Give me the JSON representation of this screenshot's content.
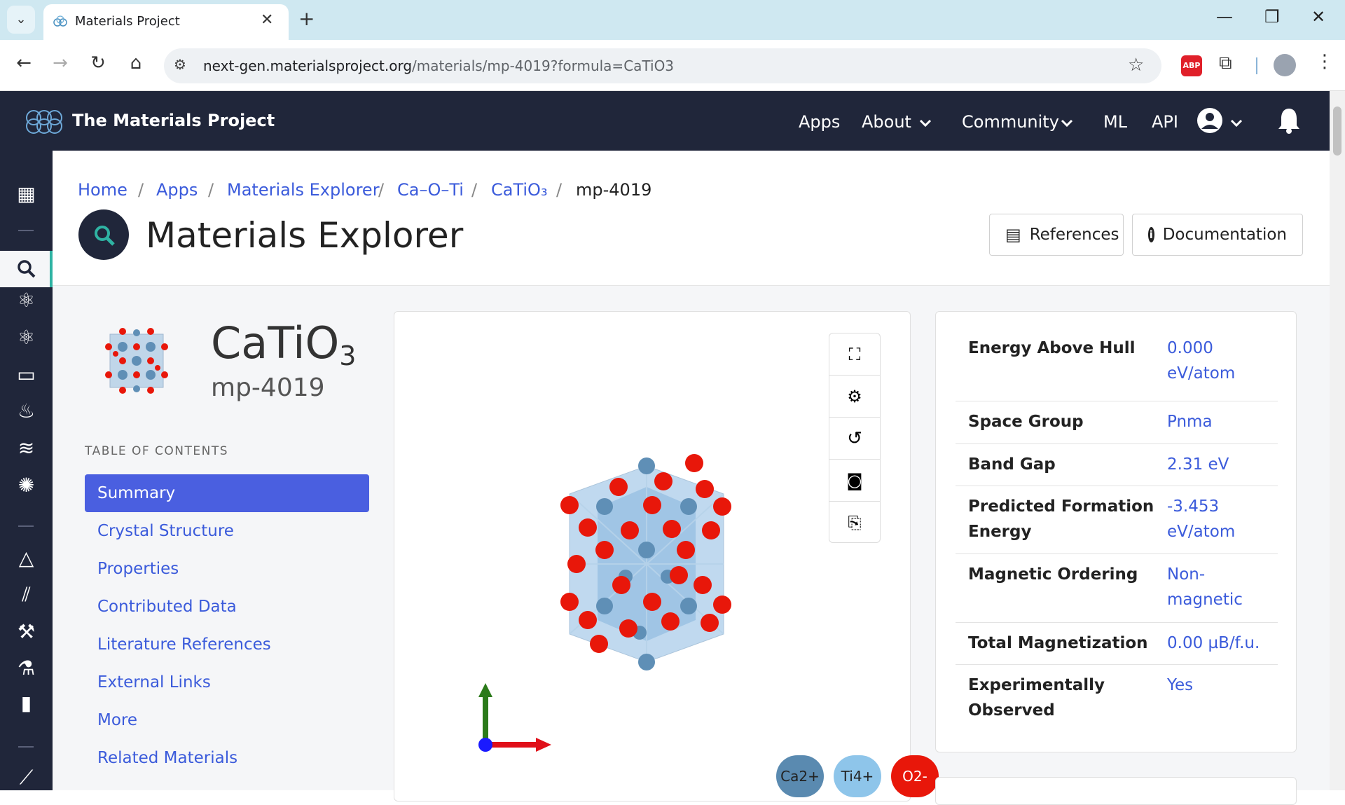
{
  "browser": {
    "tab_title": "Materials Project",
    "url_host": "next-gen.materialsproject.org",
    "url_path": "/materials/mp-4019?formula=CaTiO3"
  },
  "mp_nav": {
    "logo_text": "The Materials Project",
    "links": [
      "Apps",
      "About",
      "Community",
      "ML",
      "API"
    ]
  },
  "breadcrumb": [
    "Home",
    "Apps",
    "Materials Explorer",
    "Ca–O–Ti",
    "CaTiO₃",
    "mp-4019"
  ],
  "page": {
    "title": "Materials Explorer",
    "references_button": "References",
    "documentation_button": "Documentation"
  },
  "material": {
    "formula_main": "CaTiO",
    "formula_sub": "3",
    "id": "mp-4019"
  },
  "toc": {
    "heading": "TABLE OF CONTENTS",
    "items": [
      "Summary",
      "Crystal Structure",
      "Properties",
      "Contributed Data",
      "Literature References",
      "External Links",
      "More",
      "Related Materials"
    ],
    "active": "Summary"
  },
  "viewer": {
    "legend": [
      {
        "label": "Ca2+",
        "color": "#5a8ab0"
      },
      {
        "label": "Ti4+",
        "color": "#8ec5ea"
      },
      {
        "label": "O2-",
        "color": "#e8170a"
      }
    ]
  },
  "properties": [
    {
      "label": "Energy Above Hull",
      "value": "0.000 eV/atom"
    },
    {
      "label": "Space Group",
      "value": "Pnma"
    },
    {
      "label": "Band Gap",
      "value": "2.31 eV"
    },
    {
      "label": "Predicted Formation Energy",
      "value": "-3.453 eV/atom"
    },
    {
      "label": "Magnetic Ordering",
      "value": "Non-magnetic"
    },
    {
      "label": "Total Magnetization",
      "value": "0.00 µB/f.u."
    },
    {
      "label": "Experimentally Observed",
      "value": "Yes"
    }
  ],
  "colors": {
    "navbar": "#20263a",
    "accent": "#4a5fe0",
    "link": "#3b5bdb",
    "tabstrip": "#cfe8f1"
  }
}
